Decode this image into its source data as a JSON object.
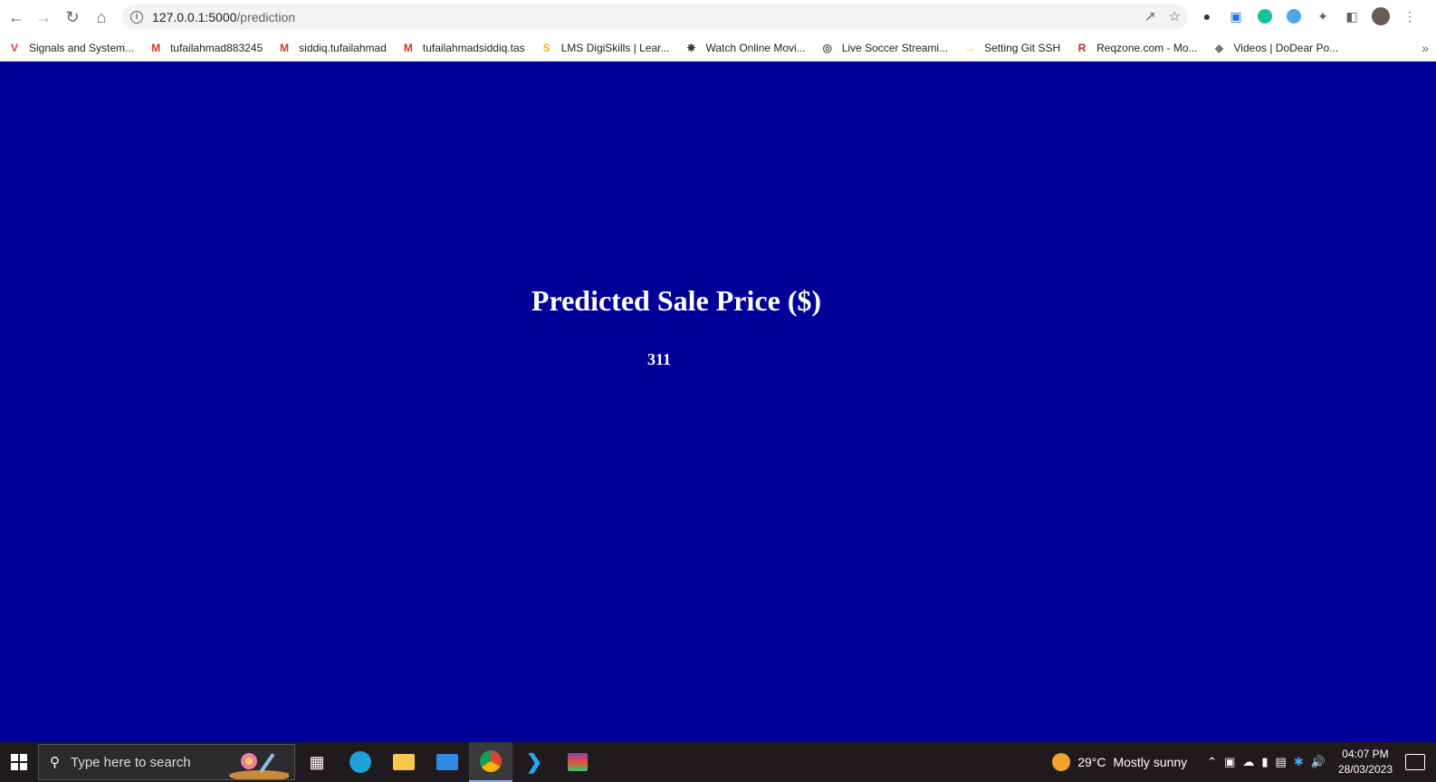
{
  "browser": {
    "url_host": "127.0.0.1:5000",
    "url_path": "/prediction"
  },
  "bookmarks": [
    {
      "label": "Signals and System...",
      "icon": "v-logo-icon",
      "color": "#e8344e"
    },
    {
      "label": "tufailahmad883245",
      "icon": "gmail-icon",
      "color": "#d93025"
    },
    {
      "label": "siddiq.tufailahmad",
      "icon": "gmail-icon",
      "color": "#d93025"
    },
    {
      "label": "tufailahmadsiddiq.tas",
      "icon": "gmail-icon",
      "color": "#d93025"
    },
    {
      "label": "LMS DigiSkills | Lear...",
      "icon": "digiskills-icon",
      "color": "#f4b400"
    },
    {
      "label": "Watch Online Movi...",
      "icon": "film-reel-icon",
      "color": "#333333"
    },
    {
      "label": "Live Soccer Streami...",
      "icon": "soccer-ball-icon",
      "color": "#555555"
    },
    {
      "label": "Setting Git SSH",
      "icon": "arrow-icon",
      "color": "#f4b400"
    },
    {
      "label": "Reqzone.com - Mo...",
      "icon": "reqzone-icon",
      "color": "#c62828"
    },
    {
      "label": "Videos | DoDear Po...",
      "icon": "dodear-icon",
      "color": "#777777"
    }
  ],
  "page": {
    "heading": "Predicted Sale Price ($)",
    "value": "311",
    "background": "#000099"
  },
  "taskbar": {
    "search_placeholder": "Type here to search",
    "weather_temp": "29°C",
    "weather_text": "Mostly sunny",
    "time": "04:07 PM",
    "date": "28/03/2023"
  }
}
